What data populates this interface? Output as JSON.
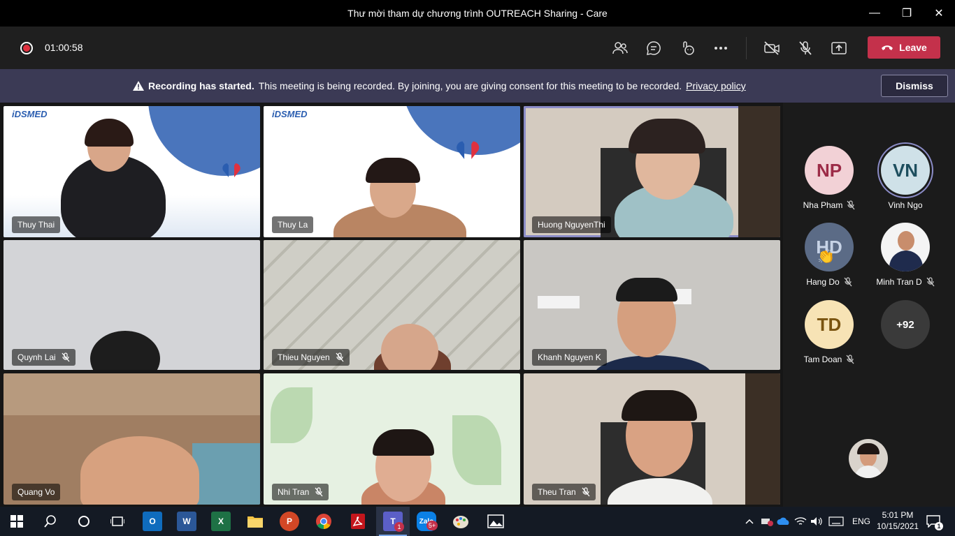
{
  "window": {
    "title": "Thư mời tham dự chương trình OUTREACH Sharing - Care",
    "minimize": "—",
    "maximize": "❐",
    "close": "✕"
  },
  "toolbar": {
    "timer": "01:00:58",
    "leave_label": "Leave",
    "icons": [
      "participants-icon",
      "chat-icon",
      "reactions-icon",
      "more-options-icon",
      "camera-off-icon",
      "mic-off-icon",
      "share-screen-icon"
    ]
  },
  "banner": {
    "title": "Recording has started.",
    "message": "This meeting is being recorded. By joining, you are giving consent for this meeting to be recorded.",
    "link": "Privacy policy",
    "dismiss_label": "Dismiss"
  },
  "video_tiles": [
    {
      "name": "Thuy Thai",
      "muted": false
    },
    {
      "name": "Thuy La",
      "muted": false
    },
    {
      "name": "Huong NguyenThi",
      "muted": false
    },
    {
      "name": "Quynh Lai",
      "muted": true
    },
    {
      "name": "Thieu Nguyen",
      "muted": true
    },
    {
      "name": "Khanh Nguyen K",
      "muted": false
    },
    {
      "name": "Quang Vo",
      "muted": false
    },
    {
      "name": "Nhi Tran",
      "muted": true
    },
    {
      "name": "Theu Tran",
      "muted": true
    }
  ],
  "tile_logo": "iDSMED",
  "roster": [
    {
      "initials": "NP",
      "name": "Nha Pham",
      "muted": true
    },
    {
      "initials": "VN",
      "name": "Vinh Ngo",
      "muted": false
    },
    {
      "initials": "HD",
      "name": "Hang Do",
      "muted": true,
      "reaction": "👏"
    },
    {
      "initials": "",
      "name": "Minh Tran D",
      "muted": true
    },
    {
      "initials": "TD",
      "name": "Tam Doan",
      "muted": true
    },
    {
      "initials": "+92",
      "name": "",
      "muted": false
    }
  ],
  "taskbar": {
    "apps": [
      "start-icon",
      "search-icon",
      "cortana-icon",
      "task-view-icon",
      "outlook-icon",
      "word-icon",
      "excel-icon",
      "file-explorer-icon",
      "powerpoint-icon",
      "chrome-icon",
      "acrobat-icon",
      "teams-icon",
      "zalo-icon",
      "paint-icon",
      "photos-icon"
    ],
    "teams_badge": "1",
    "zalo_badge": "5+",
    "language": "ENG",
    "time": "5:01 PM",
    "date": "10/15/2021",
    "notification_count": "1"
  },
  "colors": {
    "leave": "#c4314b",
    "banner": "#3b3a55",
    "active_speaker": "#8b8cc7"
  }
}
